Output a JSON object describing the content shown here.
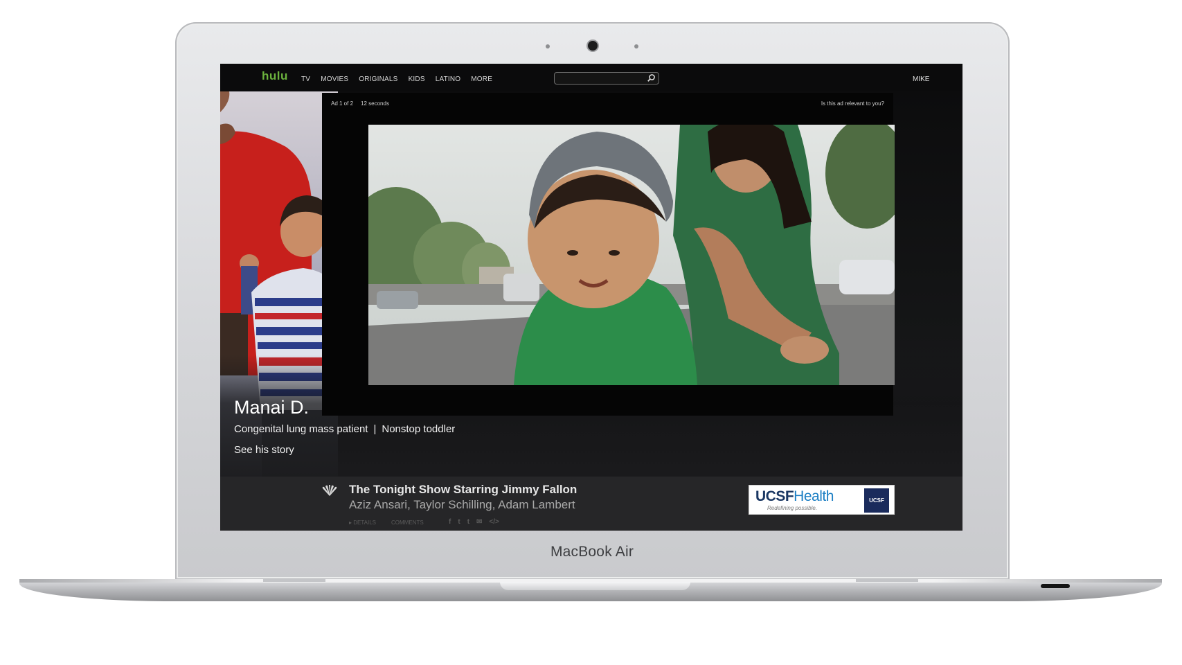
{
  "device": {
    "label": "MacBook Air"
  },
  "nav": {
    "logo": "hulu",
    "links": [
      "TV",
      "MOVIES",
      "ORIGINALS",
      "KIDS",
      "LATINO",
      "MORE"
    ],
    "search_placeholder": "",
    "user": "MIKE"
  },
  "ad": {
    "counter": "Ad 1 of 2",
    "duration": "12 seconds",
    "relevance_prompt": "Is this ad relevant to you?"
  },
  "hero": {
    "name": "Manai D.",
    "subtitle_left": "Congenital lung mass patient",
    "separator": "|",
    "subtitle_right": "Nonstop toddler",
    "link": "See his story"
  },
  "show": {
    "network_icon": "peacock-icon",
    "title": "The Tonight Show Starring Jimmy Fallon",
    "guests": "Aziz Ansari, Taylor Schilling, Adam Lambert",
    "tabs": [
      "▸ DETAILS",
      "COMMENTS"
    ],
    "share_icons": [
      "f",
      "t",
      "t",
      "✉",
      "</>"
    ]
  },
  "sponsor": {
    "brand": "UCSF",
    "brand_suffix": "Health",
    "tagline": "Redefining possible.",
    "badge": "UCSF"
  },
  "colors": {
    "hulu_green": "#6cb33e",
    "screen_bg": "#000000",
    "info_bar": "#262628",
    "ucsf_navy": "#1a2b5c",
    "ucsf_blue": "#1c7fc4"
  }
}
